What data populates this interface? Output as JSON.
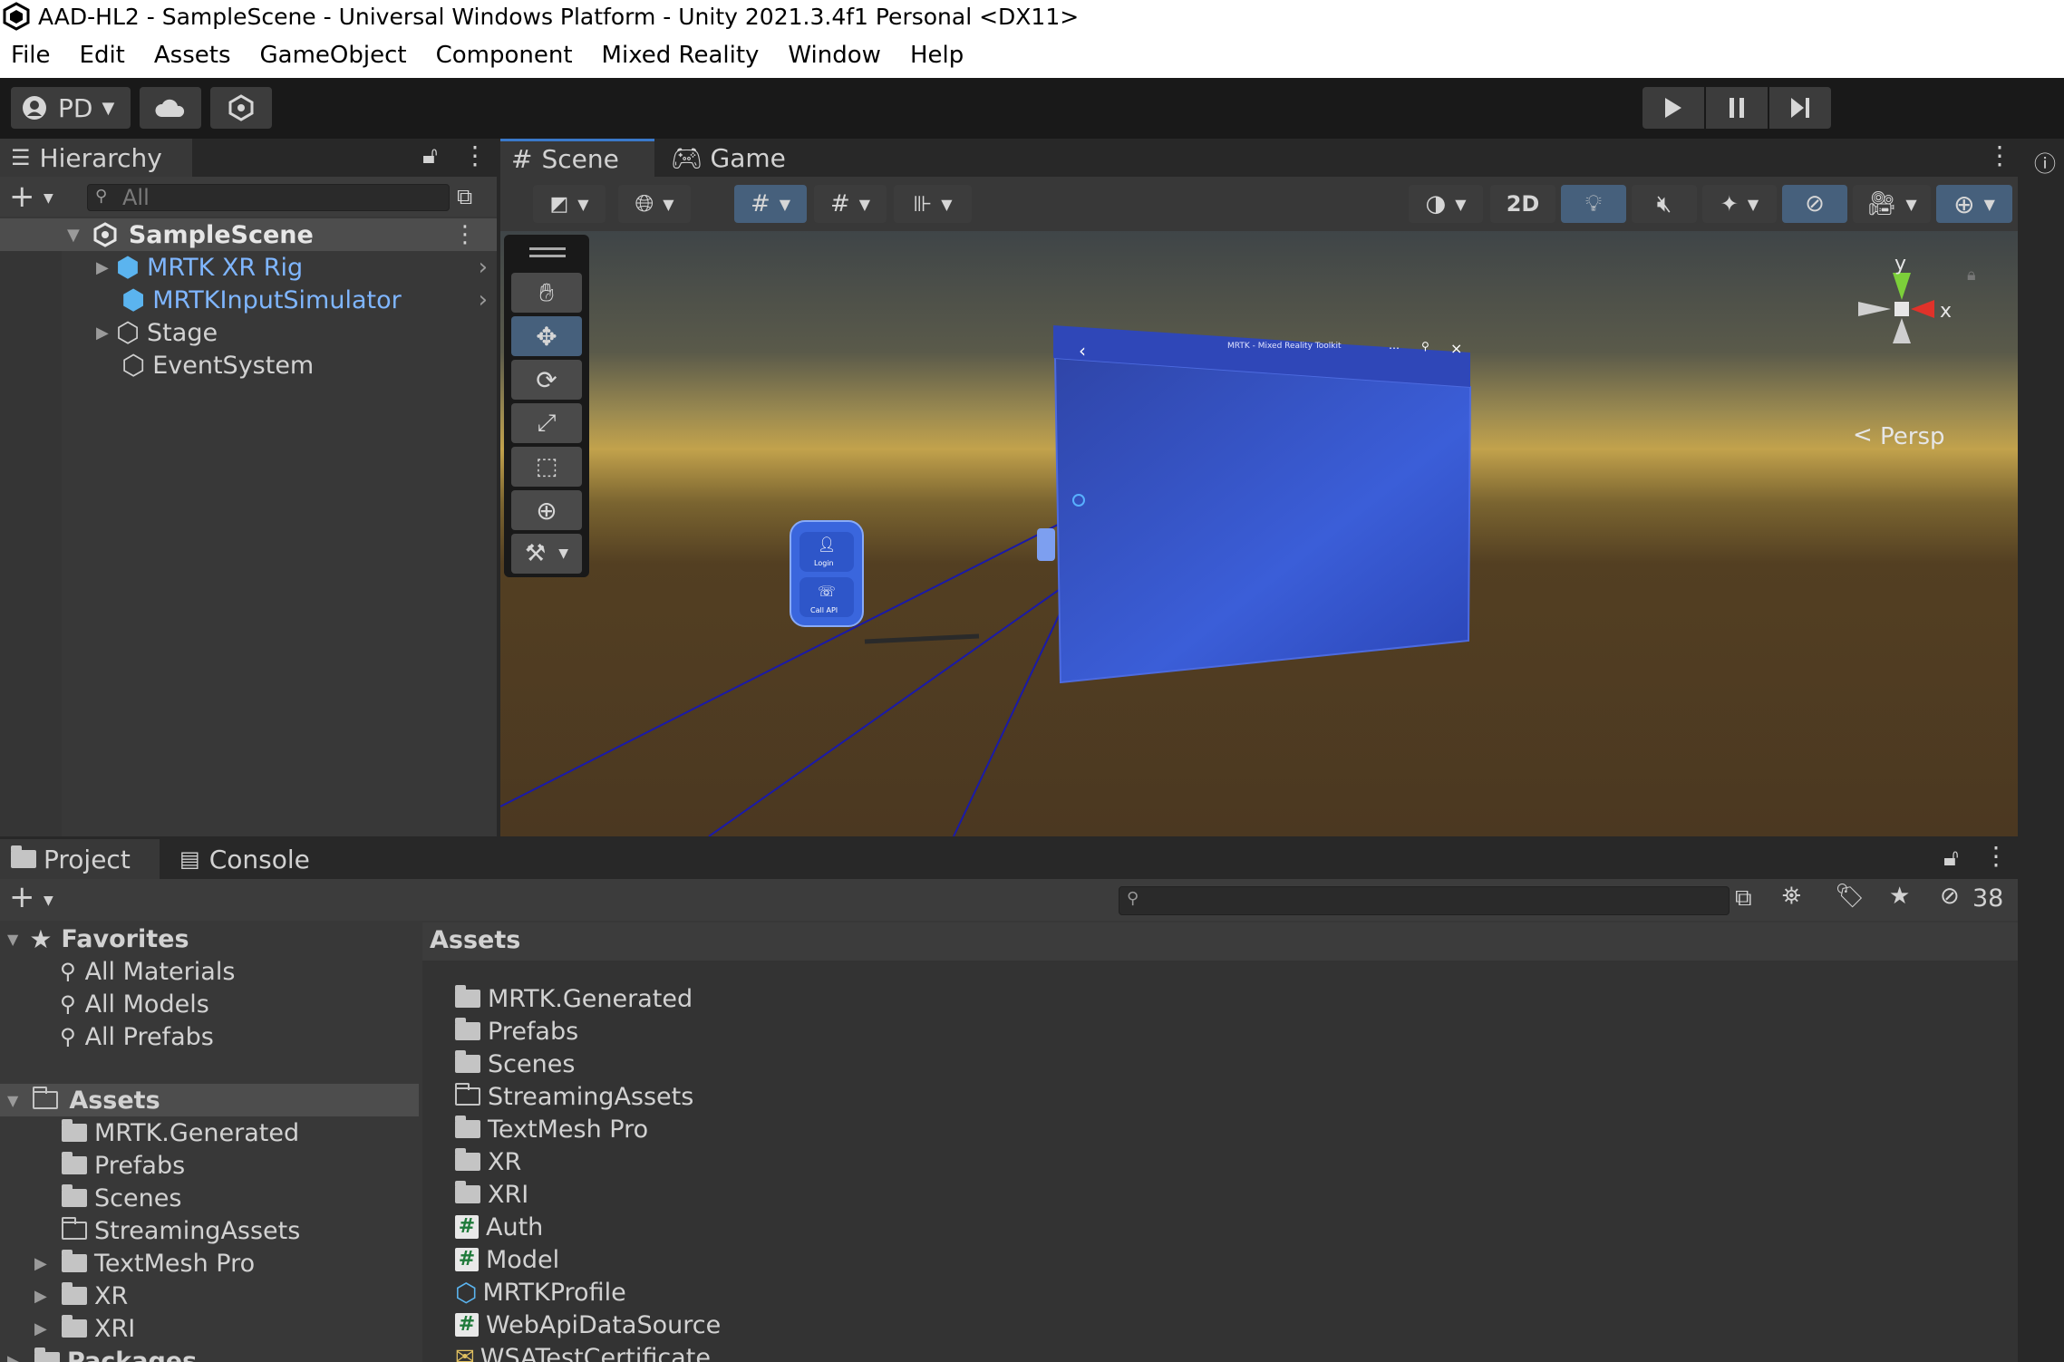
{
  "window": {
    "title": "AAD-HL2 - SampleScene - Universal Windows Platform - Unity 2021.3.4f1 Personal <DX11>"
  },
  "menu": [
    "File",
    "Edit",
    "Assets",
    "GameObject",
    "Component",
    "Mixed Reality",
    "Window",
    "Help"
  ],
  "toolbar": {
    "account": "PD"
  },
  "hierarchy": {
    "tab": "Hierarchy",
    "search_placeholder": "All",
    "scene": "SampleScene",
    "items": [
      "MRTK XR Rig",
      "MRTKInputSimulator",
      "Stage",
      "EventSystem"
    ]
  },
  "scene_view": {
    "tabs": [
      "Scene",
      "Game"
    ],
    "toggle_2d": "2D",
    "gizmo": {
      "y": "y",
      "x": "x",
      "persp": "Persp"
    },
    "panel_title": "MRTK - Mixed Reality Toolkit",
    "hand_menu": [
      "Login",
      "Call API"
    ]
  },
  "project": {
    "tabs": [
      "Project",
      "Console"
    ],
    "hidden_count": "38",
    "favorites": {
      "label": "Favorites",
      "items": [
        "All Materials",
        "All Models",
        "All Prefabs"
      ]
    },
    "tree": {
      "root": "Assets",
      "items": [
        "MRTK.Generated",
        "Prefabs",
        "Scenes",
        "StreamingAssets",
        "TextMesh Pro",
        "XR",
        "XRI"
      ],
      "packages": "Packages"
    },
    "breadcrumb": "Assets",
    "assets": [
      {
        "name": "MRTK.Generated",
        "icon": "folder"
      },
      {
        "name": "Prefabs",
        "icon": "folder"
      },
      {
        "name": "Scenes",
        "icon": "folder"
      },
      {
        "name": "StreamingAssets",
        "icon": "folder-empty"
      },
      {
        "name": "TextMesh Pro",
        "icon": "folder"
      },
      {
        "name": "XR",
        "icon": "folder"
      },
      {
        "name": "XRI",
        "icon": "folder"
      },
      {
        "name": "Auth",
        "icon": "cs-script"
      },
      {
        "name": "Model",
        "icon": "cs-script"
      },
      {
        "name": "MRTKProfile",
        "icon": "scriptable-object"
      },
      {
        "name": "WebApiDataSource",
        "icon": "cs-script"
      },
      {
        "name": "WSATestCertificate",
        "icon": "certificate"
      }
    ]
  },
  "colors": {
    "accent_blue": "#3a79c9",
    "selection": "#46607c",
    "panel": "#383838",
    "toolbar": "#191919"
  }
}
